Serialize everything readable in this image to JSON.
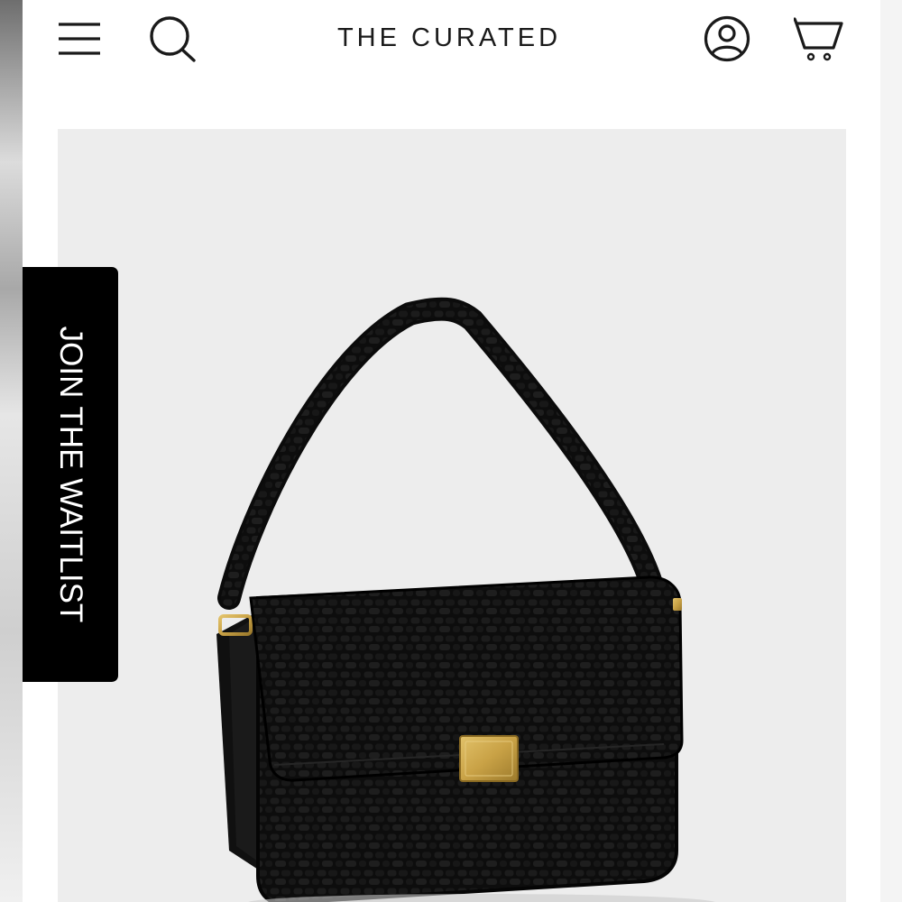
{
  "header": {
    "brand": "THE CURATED",
    "menu_icon": "hamburger-menu-icon",
    "search_icon": "search-icon",
    "account_icon": "account-user-icon",
    "cart_icon": "shopping-cart-icon"
  },
  "product": {
    "image": "black croc-embossed leather shoulder bag with gold clasp"
  },
  "waitlist": {
    "label": "JOIN THE WAITLIST"
  },
  "colors": {
    "background": "#ffffff",
    "image_background": "#ededed",
    "tab_background": "#000000",
    "hardware_gold": "#c9a246"
  }
}
